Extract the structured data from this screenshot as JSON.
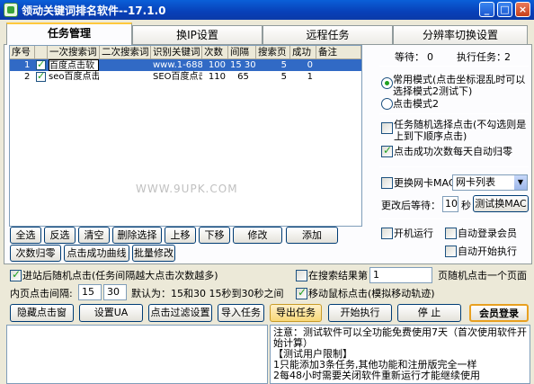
{
  "window": {
    "title": "领动关键词排名软件--17.1.0",
    "minimize": "_",
    "maximize": "□",
    "close": "×"
  },
  "tabs": [
    "任务管理",
    "换IP设置",
    "远程任务",
    "分辨率切换设置"
  ],
  "table": {
    "headers": [
      "序号",
      "一次搜索词",
      "二次搜索词",
      "识别关键词",
      "次数",
      "间隔",
      "搜索页",
      "成功",
      "备注"
    ],
    "rows": [
      {
        "num": "1",
        "checked": true,
        "search1": "百度点击软",
        "search2": "",
        "keyword": "www.1-688.",
        "count": "100",
        "interval": "15 30",
        "page": "5",
        "success": "0",
        "note": ""
      },
      {
        "num": "2",
        "checked": true,
        "search1": "seo百度点击",
        "search2": "",
        "keyword": "SEO百度点击",
        "count": "110",
        "interval": "65",
        "page": "5",
        "success": "1",
        "note": ""
      }
    ]
  },
  "right_panel": {
    "waiting_label": "等待：",
    "waiting_value": "0",
    "executing_label": "执行任务：",
    "executing_value": "2",
    "mode1": "常用模式(点击坐标混乱时可以选择模式2测试下)",
    "mode2": "点击模式2",
    "random_click": "任务随机选择点击(不勾选则是上到下顺序点击)",
    "auto_reset": "点击成功次数每天自动归零",
    "change_mac": "更换网卡MAC",
    "nic_select": "网卡列表",
    "wait_after_label": "更改后等待：",
    "wait_after_value": "10",
    "wait_after_unit": "秒",
    "test_mac": "测试换MAC",
    "auto_run": "开机运行",
    "auto_login": "自动登录会员",
    "auto_start": "自动开始执行"
  },
  "table_buttons": [
    "全选",
    "反选",
    "清空",
    "删除选择",
    "上移",
    "下移",
    "修改",
    "添加"
  ],
  "table_buttons2": [
    "次数归零",
    "点击成功曲线",
    "批量修改"
  ],
  "options": {
    "random_inner_click": "进站后随机点击(任务间隔越大点击次数越多)",
    "inner_interval_label": "内页点击间隔:",
    "inner_interval_min": "15",
    "inner_interval_max": "30",
    "inner_interval_hint": "默认为：15和30 15秒到30秒之间",
    "search_result_label": "在搜索结果第",
    "search_result_value": "1",
    "search_result_suffix": "页随机点击一个页面",
    "move_mouse": "移动鼠标点击(模拟移动轨迹)"
  },
  "bottom_buttons": [
    "隐藏点击窗",
    "设置UA",
    "点击过滤设置",
    "导入任务",
    "导出任务",
    "开始执行",
    "停 止",
    "会员登录"
  ],
  "notice": {
    "lines": [
      "注意：测试软件可以全功能免费使用7天（首次使用软件开始计算）",
      "【测试用户限制】",
      "1只能添加3条任务,其他功能和注册版完全一样",
      "2每48小时需要关闭软件重新运行才能继续使用"
    ]
  },
  "watermark": "WWW.9UPK.COM"
}
